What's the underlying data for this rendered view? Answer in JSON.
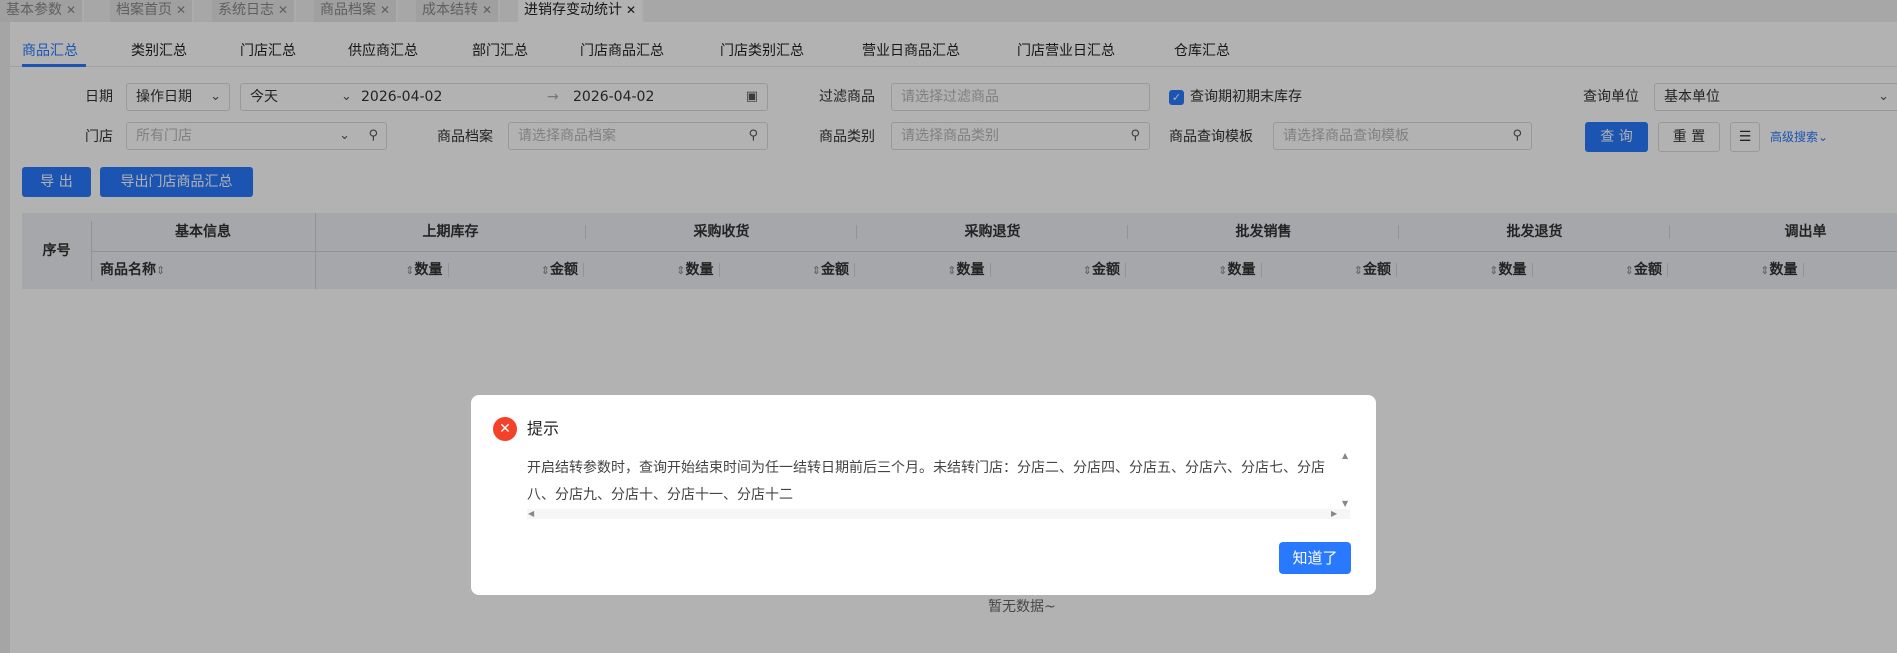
{
  "tabs": [
    {
      "label": "基本参数"
    },
    {
      "label": "档案首页"
    },
    {
      "label": "系统日志"
    },
    {
      "label": "商品档案"
    },
    {
      "label": "成本结转"
    },
    {
      "label": "进销存变动统计"
    }
  ],
  "close_glyph": "✕",
  "subtabs": [
    {
      "label": "商品汇总"
    },
    {
      "label": "类别汇总"
    },
    {
      "label": "门店汇总"
    },
    {
      "label": "供应商汇总"
    },
    {
      "label": "部门汇总"
    },
    {
      "label": "门店商品汇总"
    },
    {
      "label": "门店类别汇总"
    },
    {
      "label": "营业日商品汇总"
    },
    {
      "label": "门店营业日汇总"
    },
    {
      "label": "仓库汇总"
    }
  ],
  "filters": {
    "date_label": "日期",
    "date_type": "操作日期",
    "date_preset": "今天",
    "start_date": "2026-04-02",
    "end_date": "2026-04-02",
    "range_sep": "→",
    "filter_goods_label": "过滤商品",
    "filter_goods_placeholder": "请选择过滤商品",
    "query_opening_closing": "查询期初期末库存",
    "unit_label": "查询单位",
    "unit_value": "基本单位",
    "store_label": "门店",
    "store_placeholder": "所有门店",
    "goods_file_label": "商品档案",
    "goods_file_placeholder": "请选择商品档案",
    "category_label": "商品类别",
    "category_placeholder": "请选择商品类别",
    "template_label": "商品查询模板",
    "template_placeholder": "请选择商品查询模板",
    "query_btn": "查 询",
    "reset_btn": "重 置",
    "advanced": "高级搜索"
  },
  "actions": {
    "export": "导 出",
    "export_store": "导出门店商品汇总"
  },
  "table": {
    "seq": "序号",
    "basic": "基本信息",
    "name": "商品名称",
    "groups": [
      {
        "label": "上期库存"
      },
      {
        "label": "采购收货"
      },
      {
        "label": "采购退货"
      },
      {
        "label": "批发销售"
      },
      {
        "label": "批发退货"
      },
      {
        "label": "调出单"
      }
    ],
    "qty": "数量",
    "amount": "金额",
    "empty": "暂无数据~"
  },
  "dialog": {
    "title": "提示",
    "message": "开启结转参数时，查询开始结束时间为任一结转日期前后三个月。未结转门店：分店二、分店四、分店五、分店六、分店七、分店八、分店九、分店十、分店十一、分店十二",
    "ok": "知道了"
  }
}
